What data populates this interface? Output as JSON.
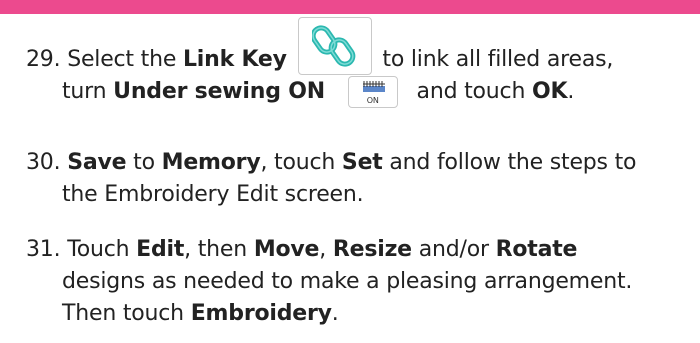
{
  "steps": [
    {
      "number": "29.",
      "line1": {
        "before": "Select the ",
        "bold1": "Link Key",
        "after": " to link all filled areas,"
      },
      "line2": {
        "before": "turn ",
        "bold1": "Under sewing ON",
        "mid": " and touch ",
        "bold2": "OK",
        "after": "."
      }
    },
    {
      "number": "30.",
      "line1": {
        "bold1": "Save",
        "mid1": " to ",
        "bold2": "Memory",
        "mid2": ", touch ",
        "bold3": "Set",
        "after": " and follow the steps to"
      },
      "line2": {
        "text": "the Embroidery Edit screen."
      }
    },
    {
      "number": "31.",
      "line1": {
        "before": "Touch ",
        "bold1": "Edit",
        "mid1": ", then ",
        "bold2": "Move",
        "mid2": ", ",
        "bold3": "Resize",
        "mid3": " and/or ",
        "bold4": "Rotate"
      },
      "line2": {
        "text": "designs as needed to make a pleasing arrangement."
      },
      "line3": {
        "before": "Then touch ",
        "bold1": "Embroidery",
        "after": "."
      }
    }
  ],
  "icons": {
    "link_key": "link-chain-icon",
    "under_sewing": "under-sewing-icon",
    "under_sewing_label": "ON",
    "accent_color": "#ec4a8e",
    "link_color": "#2bb8b0"
  }
}
